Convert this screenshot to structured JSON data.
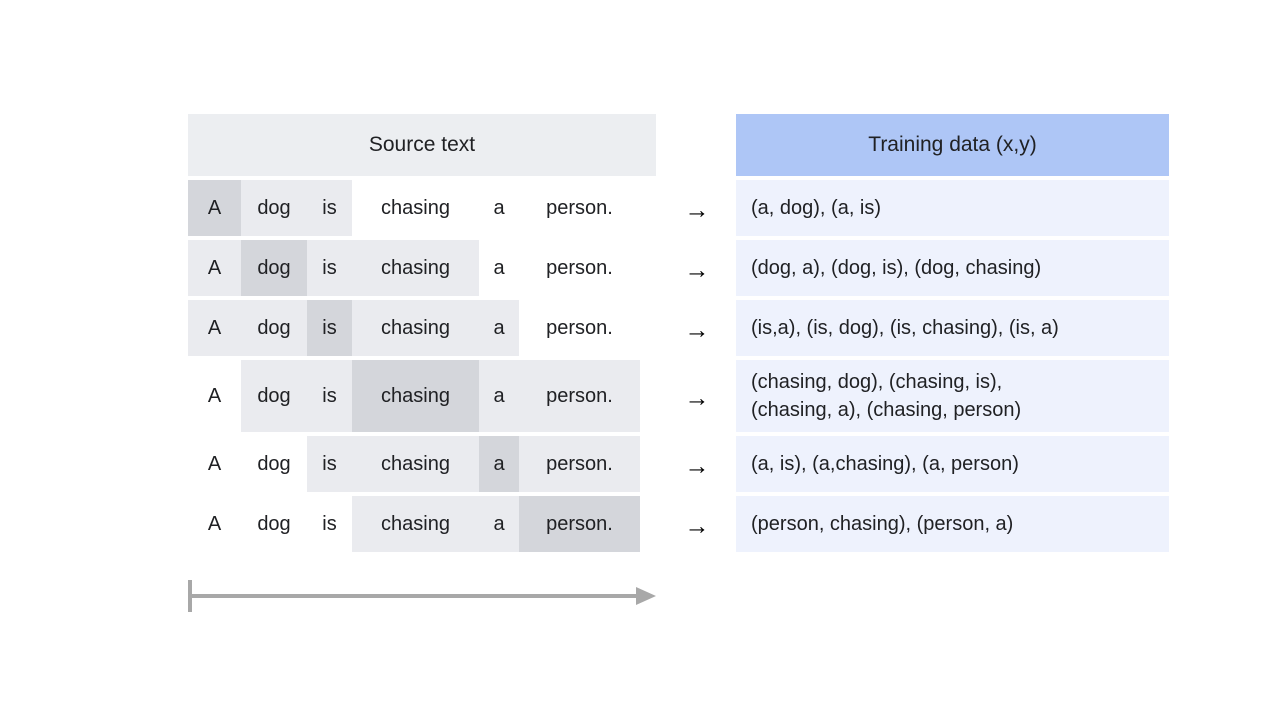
{
  "headers": {
    "source": "Source text",
    "training": "Training data (x,y)"
  },
  "colors": {
    "source_header_bg": "#eceef1",
    "training_header_bg": "#aec6f6",
    "training_row_bg": "#eef2fd",
    "context_highlight": "#eaebef",
    "target_highlight": "#d4d6db",
    "page_bg": "#ffffff",
    "axis": "#a8a8a8",
    "text": "#202124"
  },
  "tokens": [
    "A",
    "dog",
    "is",
    "chasing",
    "a",
    "person."
  ],
  "rows": [
    {
      "tokens": [
        "A",
        "dog",
        "is",
        "chasing",
        "a",
        "person."
      ],
      "states": [
        "target",
        "context",
        "context",
        "none",
        "none",
        "none"
      ],
      "arrow": "→",
      "training": "(a, dog), (a, is)"
    },
    {
      "tokens": [
        "A",
        "dog",
        "is",
        "chasing",
        "a",
        "person."
      ],
      "states": [
        "context",
        "target",
        "context",
        "context",
        "none",
        "none"
      ],
      "arrow": "→",
      "training": "(dog, a), (dog, is), (dog, chasing)"
    },
    {
      "tokens": [
        "A",
        "dog",
        "is",
        "chasing",
        "a",
        "person."
      ],
      "states": [
        "context",
        "context",
        "target",
        "context",
        "context",
        "none"
      ],
      "arrow": "→",
      "training": "(is,a), (is, dog), (is, chasing), (is, a)"
    },
    {
      "tokens": [
        "A",
        "dog",
        "is",
        "chasing",
        "a",
        "person."
      ],
      "states": [
        "none",
        "context",
        "context",
        "target",
        "context",
        "context"
      ],
      "arrow": "→",
      "training": "(chasing, dog), (chasing, is),\n(chasing, a), (chasing, person)"
    },
    {
      "tokens": [
        "A",
        "dog",
        "is",
        "chasing",
        "a",
        "person."
      ],
      "states": [
        "none",
        "none",
        "context",
        "context",
        "target",
        "context"
      ],
      "arrow": "→",
      "training": "(a, is), (a,chasing), (a, person)"
    },
    {
      "tokens": [
        "A",
        "dog",
        "is",
        "chasing",
        "a",
        "person."
      ],
      "states": [
        "none",
        "none",
        "none",
        "context",
        "context",
        "target"
      ],
      "arrow": "→",
      "training": "(person, chasing), (person, a)"
    }
  ],
  "axis": {
    "label": "",
    "icon": "right-arrow-axis"
  }
}
